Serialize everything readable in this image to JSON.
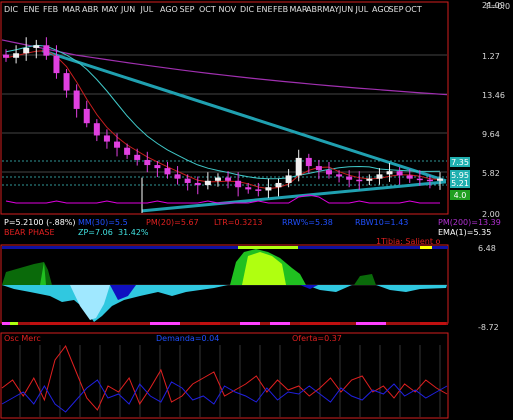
{
  "colors": {
    "bg": "#000000",
    "frame": "#d21e1e",
    "grid": "#5a5a5a",
    "price_axis_text": "#d8d8d8",
    "month_text": "#e0e0e0",
    "candle_up": "#f0f0f0",
    "candle_down": "#e040e0",
    "ma_red": "#c81e1e",
    "ma_cyan": "#40c8c8",
    "ma_purple": "#a030b0",
    "trendline": "#20a0b0",
    "volume_line": "#e000e0",
    "osc_dark_green": "#0a6a0a",
    "osc_green": "#20c020",
    "osc_lime": "#b0ff10",
    "osc_cyan": "#30c8e0",
    "osc_blue": "#1010c0",
    "osc_light_blue": "#a0e8ff",
    "bottom_red": "#e02020",
    "bottom_blue": "#2020e0",
    "info_white": "#ffffff",
    "info_blue": "#2050ff",
    "info_red": "#e02020",
    "info_cyan": "#40e0e0"
  },
  "header": {
    "months": [
      "DIC",
      "ENE",
      "FEB",
      "MAR",
      "ABR",
      "MAY",
      "JUN",
      "JUL",
      "AGO",
      "SEP",
      "OCT",
      "NOV",
      "DIC",
      "ENE",
      "FEB",
      "MAR",
      "ABR",
      "MAY",
      "JUN",
      "JUL",
      "AGO",
      "SEP",
      "OCT"
    ],
    "f_label": "F=0.0"
  },
  "price_axis": {
    "labels": [
      "21.09",
      "1.27",
      "13.46",
      "9.64",
      "5.82",
      "2.00"
    ]
  },
  "right_boxes": [
    {
      "text": "7.35",
      "color": "#20b0b0"
    },
    {
      "text": "5.95",
      "color": "#20b0b0"
    },
    {
      "text": "5.21",
      "color": "#20b0b0"
    },
    {
      "text": "4.0",
      "color": "#20a020"
    }
  ],
  "info": {
    "row1": [
      {
        "text": "P=5.2100 (-.88%)",
        "color": "#ffffff"
      },
      {
        "text": "MM(30)=5.5",
        "color": "#2050ff"
      },
      {
        "text": "PM(20)=5.67",
        "color": "#e02020"
      },
      {
        "text": "LTR=0.3213",
        "color": "#e02020"
      },
      {
        "text": "RRW%=5.38",
        "color": "#2050ff"
      },
      {
        "text": "RBW10=1.43",
        "color": "#2050ff"
      },
      {
        "text": "PM(200)=13.39",
        "color": "#b030d0"
      }
    ],
    "row2": [
      {
        "text": "BEAR PHASE",
        "color": "#e02020"
      },
      {
        "text": "ZP=7.06",
        "color": "#40e0e0"
      },
      {
        "text": "31.42%",
        "color": "#40e0e0"
      },
      {
        "text": "EMA(1)=5.35",
        "color": "#ffffff"
      }
    ]
  },
  "oscillator": {
    "top_label": "1Tibia: Salient o",
    "top_value": "6.48",
    "bottom_value": "-8.72"
  },
  "bottom_panel": {
    "labels": [
      {
        "text": "Osc Merc",
        "color": "#e02020"
      },
      {
        "text": "Demanda=0.04",
        "color": "#2050ff"
      },
      {
        "text": "Oferta=0.37",
        "color": "#e02020"
      }
    ]
  },
  "chart_data": [
    {
      "type": "candlestick",
      "panel": "price",
      "ylim": [
        2.0,
        21.09
      ],
      "y_tick_labels": [
        "21.09",
        "1.27",
        "13.46",
        "9.64",
        "5.82",
        "2.00"
      ],
      "x_tick_labels": [
        "DIC",
        "ENE",
        "FEB",
        "MAR",
        "ABR",
        "MAY",
        "JUN",
        "JUL",
        "AGO",
        "SEP",
        "OCT",
        "NOV",
        "DIC",
        "ENE",
        "FEB",
        "MAR",
        "ABR",
        "MAY",
        "JUN",
        "JUL",
        "AGO",
        "SEP",
        "OCT"
      ],
      "last_price": 5.21,
      "approx_close_path": [
        17.0,
        17.4,
        17.8,
        18.0,
        17.2,
        15.5,
        13.8,
        12.0,
        10.6,
        9.4,
        8.8,
        8.2,
        7.5,
        7.0,
        6.5,
        6.2,
        5.6,
        5.2,
        4.8,
        4.6,
        5.0,
        5.3,
        5.0,
        4.4,
        4.2,
        4.1,
        4.4,
        4.8,
        5.5,
        7.2,
        6.4,
        6.0,
        5.6,
        5.4,
        5.1,
        5.0,
        5.2,
        5.6,
        5.9,
        5.5,
        5.2,
        5.1,
        5.0,
        5.2
      ],
      "moving_averages": [
        {
          "name": "MM(30)",
          "color": "#40c8c8",
          "last": 5.5
        },
        {
          "name": "PM(20)",
          "color": "#c81e1e",
          "last": 5.67
        },
        {
          "name": "PM(200)",
          "color": "#a030b0",
          "last": 13.39
        }
      ]
    },
    {
      "type": "area",
      "panel": "oscillator",
      "ylim": [
        -8.72,
        6.48
      ]
    },
    {
      "type": "line",
      "panel": "bottom",
      "series": [
        {
          "name": "Oferta",
          "color": "#e02020",
          "last": 0.37
        },
        {
          "name": "Demanda",
          "color": "#2050ff",
          "last": 0.04
        }
      ]
    }
  ]
}
